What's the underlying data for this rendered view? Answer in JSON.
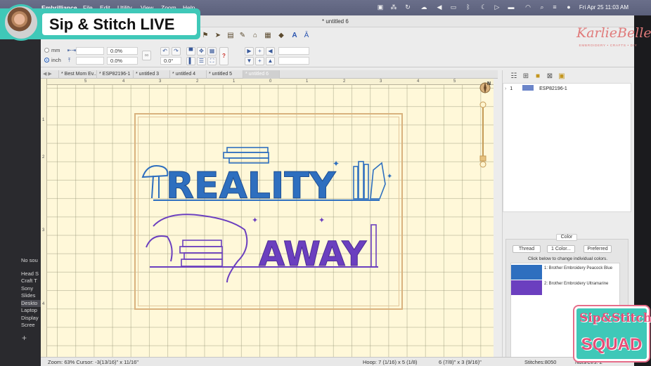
{
  "menubar": {
    "app_name": "Embrilliance",
    "menus": [
      "File",
      "Edit",
      "Utility",
      "View",
      "Zoom",
      "Help"
    ],
    "clock": "Fri Apr 25  11:03 AM"
  },
  "overlay": {
    "live_title": "Sip & Stitch LIVE",
    "brand_name": "KarlieBelle",
    "brand_sub": "EMBROIDERY • CRAFTS • DIY",
    "squad_line1": "Sip&Stitch",
    "squad_line2": "SQUAD"
  },
  "window": {
    "title": "* untitled 6"
  },
  "units": {
    "mm_label": "mm",
    "inch_label": "inch",
    "selected": "inch",
    "width_pct": "0.0%",
    "height_pct": "0.0%",
    "rotation": "0.0°"
  },
  "tabs": [
    {
      "label": "* Best Mom Ev...",
      "active": false
    },
    {
      "label": "* ESP82196-1",
      "active": false
    },
    {
      "label": "* untitled 3",
      "active": false
    },
    {
      "label": "* untitled 4",
      "active": false
    },
    {
      "label": "* untitled 5",
      "active": false
    },
    {
      "label": "* untitled 6",
      "active": true
    }
  ],
  "ruler": {
    "top_labels": [
      "5",
      "4",
      "3",
      "2",
      "1",
      "0",
      "1",
      "2",
      "3",
      "4",
      "5"
    ],
    "left_labels": [
      "1",
      "2",
      "3",
      "4"
    ]
  },
  "design": {
    "line1": "REALITY",
    "line2": "AWAY"
  },
  "layers": {
    "item_index": "1",
    "item_name": "ESP82196-1"
  },
  "color_panel": {
    "tab_label": "Color",
    "thread_button": "Thread",
    "one_color_button": "1 Color...",
    "preferred_button": "Preferred",
    "hint": "Click below to change individual colors.",
    "threads": [
      {
        "name": "1: Brother Embroidery Peacock Blue",
        "color": "#2e6fbf"
      },
      {
        "name": "2: Brother Embroidery Ultramarine",
        "color": "#6b3fbf"
      }
    ]
  },
  "finder": {
    "items": [
      "No sou",
      "Head S",
      "Craft T",
      "Sony",
      "Slides",
      "Deskto",
      "Laptop",
      "Display",
      "Scree"
    ]
  },
  "status": {
    "zoom_cursor": "Zoom: 63%  Cursor: -3(13/16)\" x 11/16\"",
    "hoop": "Hoop: 7 (1/16) x 5 (1/8)",
    "size": "6 (7/8)\" x 3 (9/16)\"",
    "stitches": "Stitches:8050",
    "ndls": "Ndls/Clrs: 2"
  },
  "colors": {
    "peacock_blue": "#2e6fbf",
    "ultramarine": "#6b3fbf",
    "canvas": "#fff8d9",
    "hoop": "#d9b27e",
    "teal": "#3fc8b8",
    "pink": "#e54f78"
  }
}
